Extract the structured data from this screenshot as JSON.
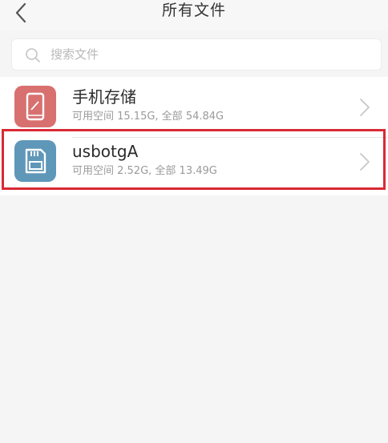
{
  "header": {
    "title": "所有文件",
    "back_icon": "chevron-left-icon"
  },
  "search": {
    "placeholder": "搜索文件",
    "icon": "search-icon"
  },
  "storage_list": [
    {
      "name": "手机存储",
      "detail": "可用空间 15.15G, 全部 54.84G",
      "icon": "phone-icon",
      "icon_color": "#d8706f"
    },
    {
      "name": "usbotgA",
      "detail": "可用空间 2.52G, 全部 13.49G",
      "icon": "sd-card-icon",
      "icon_color": "#5f97b9",
      "highlighted": true
    }
  ],
  "colors": {
    "background": "#f5f5f5",
    "highlight_border": "#d82a35"
  }
}
